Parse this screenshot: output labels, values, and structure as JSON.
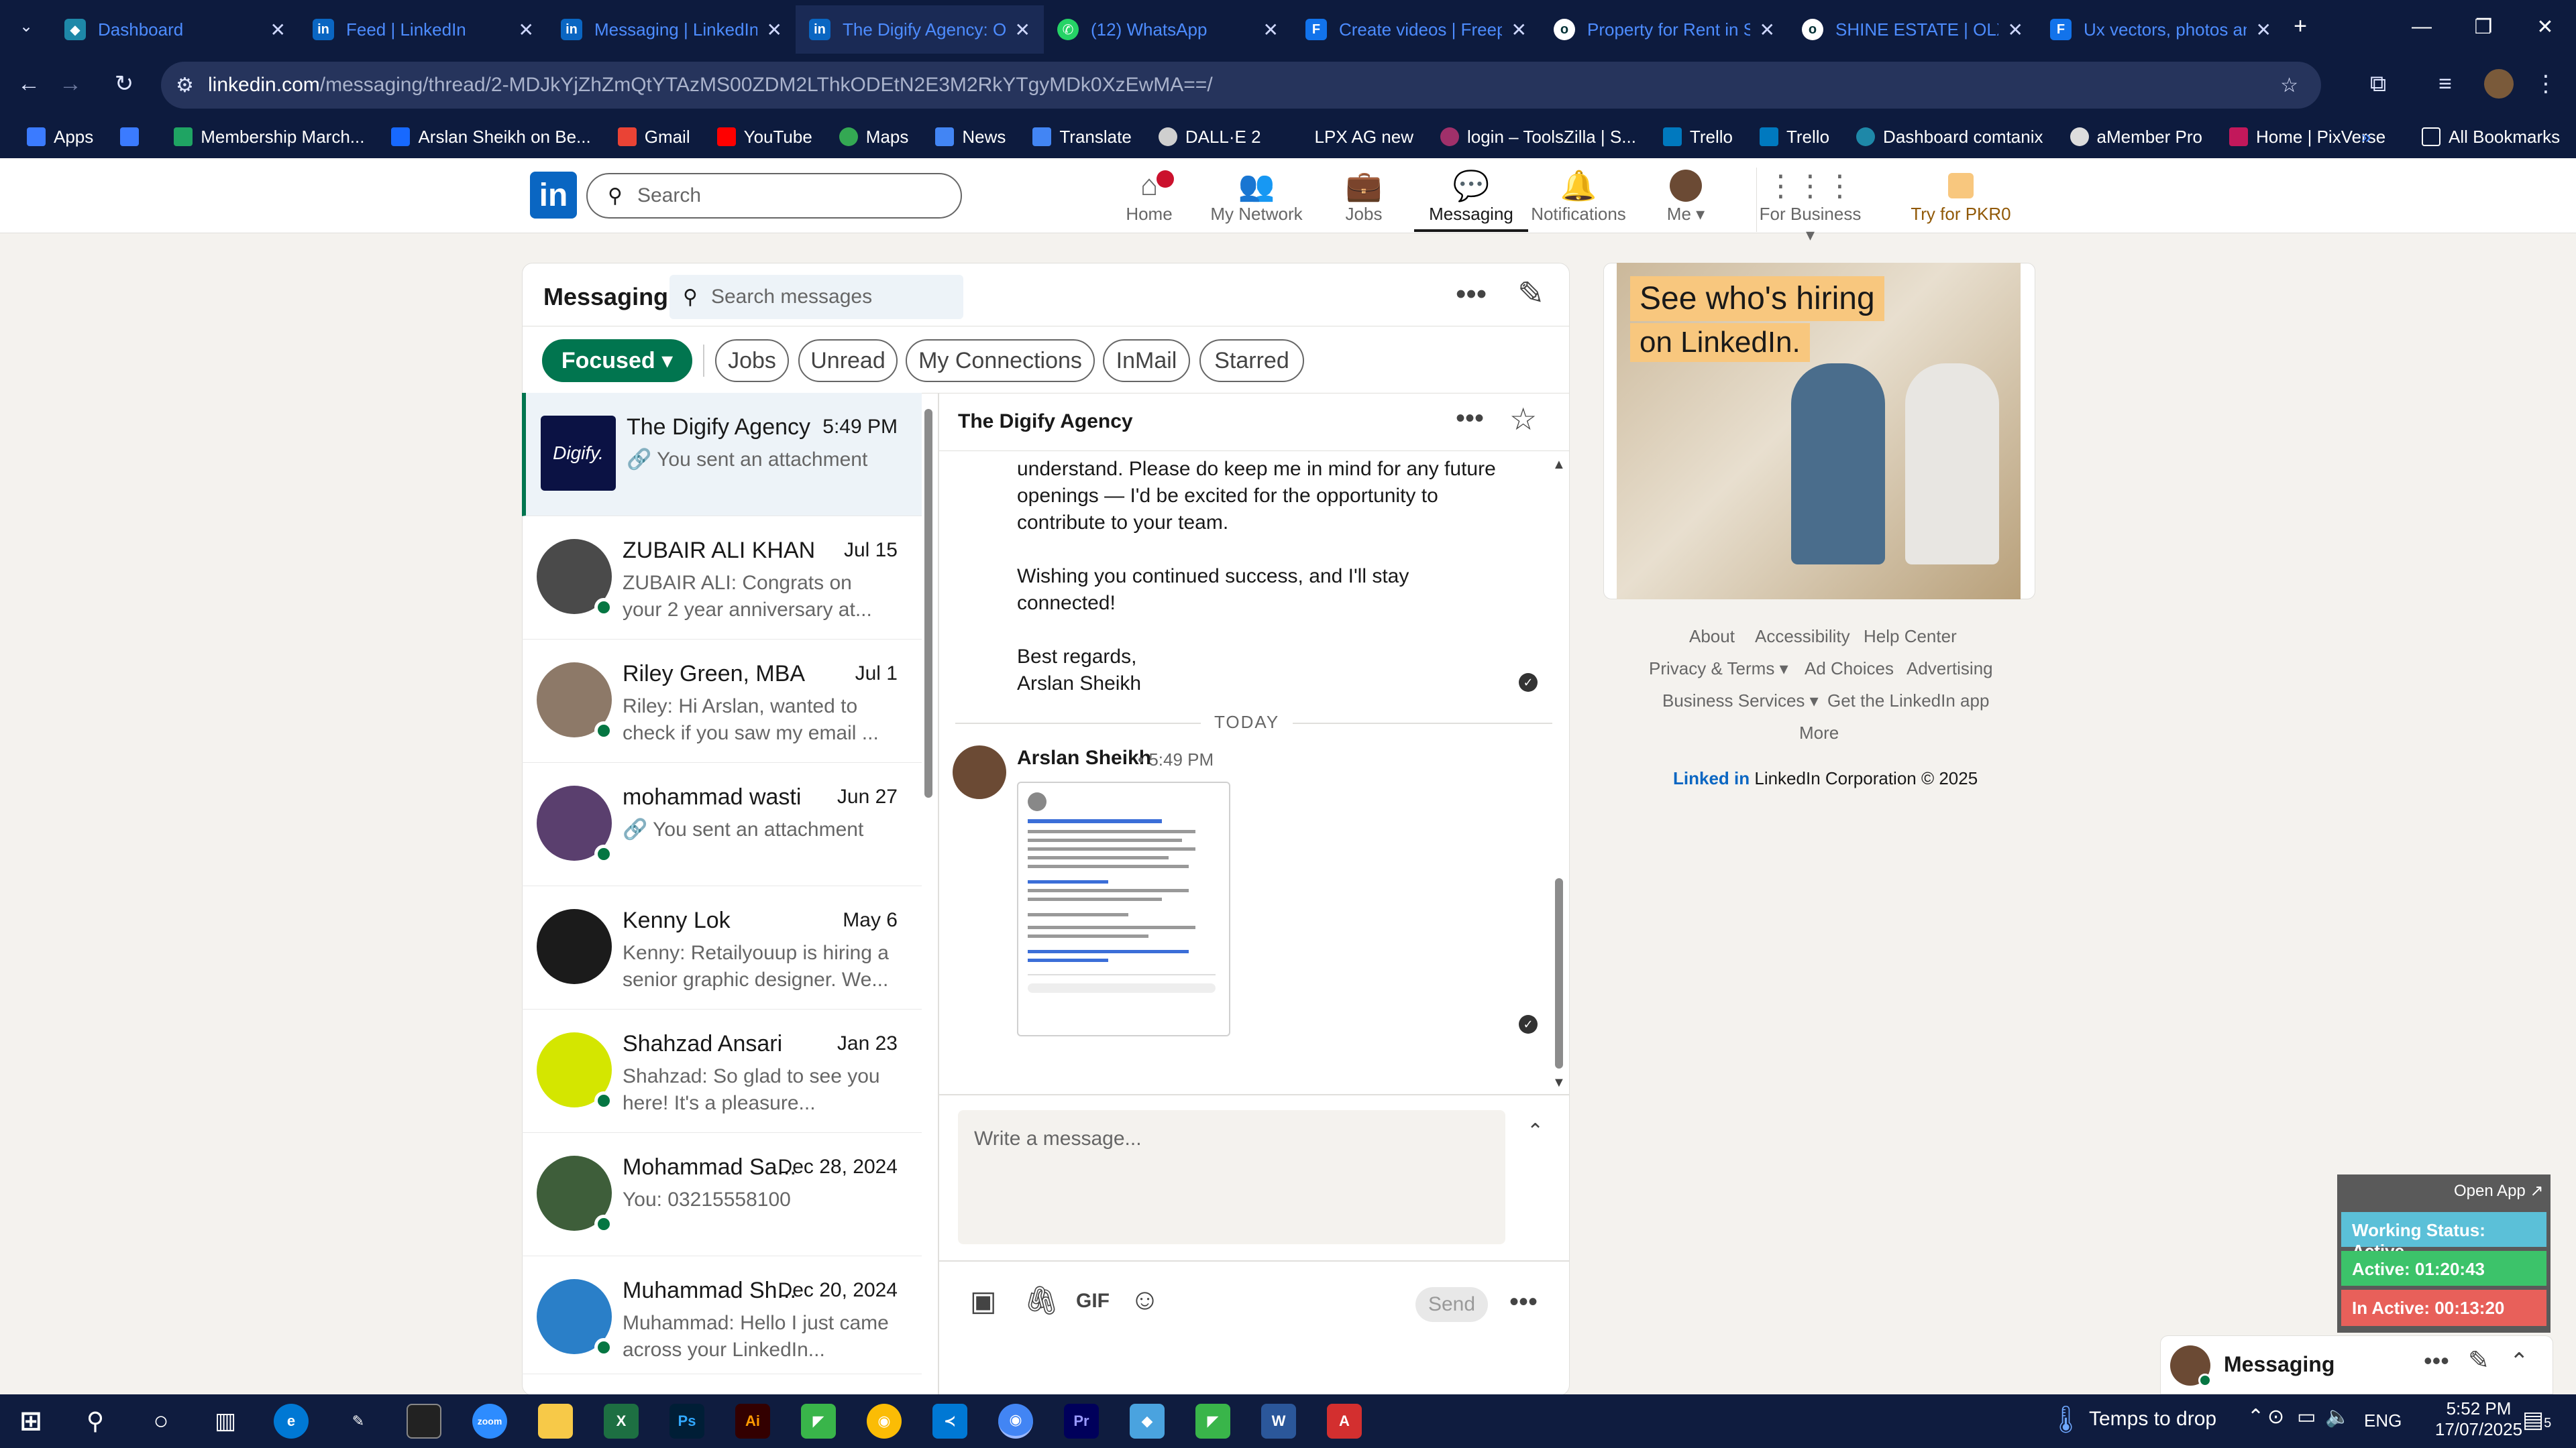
{
  "browser": {
    "tabs": [
      {
        "title": "Dashboard",
        "color": "#1e88a8"
      },
      {
        "title": "Feed | LinkedIn",
        "color": "#0a66c2"
      },
      {
        "title": "Messaging | LinkedIn",
        "color": "#0a66c2"
      },
      {
        "title": "The Digify Agency: Ov",
        "color": "#0a66c2"
      },
      {
        "title": "(12) WhatsApp",
        "color": "#25d366"
      },
      {
        "title": "Create videos | Freep",
        "color": "#1273eb"
      },
      {
        "title": "Property for Rent in S",
        "color": "#ffffff"
      },
      {
        "title": "SHINE ESTATE | OLX",
        "color": "#ffffff"
      },
      {
        "title": "Ux vectors, photos an",
        "color": "#1273eb"
      }
    ],
    "url_host": "linkedin.com",
    "url_path": "/messaging/thread/2-MDJkYjZhZmQtYTAzMS00ZDM2LThkODEtN2E3M2RkYTgyMDk0XzEwMA==/",
    "bookmarks": [
      "Apps",
      "Membership March...",
      "Arslan Sheikh on Be...",
      "Gmail",
      "YouTube",
      "Maps",
      "News",
      "Translate",
      "DALL·E 2",
      "LPX AG new",
      "login – ToolsZilla | S...",
      "Trello",
      "Trello",
      "Dashboard comtanix",
      "aMember Pro",
      "Home | PixVerse"
    ],
    "all_bookmarks": "All Bookmarks"
  },
  "linkedin_nav": {
    "logo": "in",
    "search_placeholder": "Search",
    "items": [
      "Home",
      "My Network",
      "Jobs",
      "Messaging",
      "Notifications",
      "Me",
      "For Business",
      "Try for PKR0"
    ]
  },
  "messaging": {
    "title": "Messaging",
    "search_placeholder": "Search messages",
    "filters": [
      "Focused",
      "Jobs",
      "Unread",
      "My Connections",
      "InMail",
      "Starred"
    ],
    "conversations": [
      {
        "name": "The Digify Agency",
        "date": "5:49 PM",
        "preview": "You sent an attachment"
      },
      {
        "name": "ZUBAIR ALI KHAN",
        "date": "Jul 15",
        "preview": "ZUBAIR ALI: Congrats on your 2 year anniversary at..."
      },
      {
        "name": "Riley Green, MBA",
        "date": "Jul 1",
        "preview": "Riley: Hi Arslan, wanted to check if you saw my email ..."
      },
      {
        "name": "mohammad wasti",
        "date": "Jun 27",
        "preview": "You sent an attachment"
      },
      {
        "name": "Kenny Lok",
        "date": "May 6",
        "preview": "Kenny: Retailyouup is hiring a senior graphic designer. We..."
      },
      {
        "name": "Shahzad Ansari",
        "date": "Jan 23",
        "preview": "Shahzad: So glad to see you here! It's a pleasure..."
      },
      {
        "name": "Mohammad Sa...",
        "date": "Dec 28, 2024",
        "preview": "You: 03215558100"
      },
      {
        "name": "Muhammad Sh...",
        "date": "Dec 20, 2024",
        "preview": "Muhammad: Hello I just came across your LinkedIn..."
      }
    ],
    "thread": {
      "title": "The Digify Agency",
      "body_lines": [
        "understand. Please do keep me in mind for any future",
        "openings — I'd be excited for the opportunity to",
        "contribute to your team.",
        "Wishing you continued success, and I'll stay",
        "connected!",
        "Best regards,",
        "Arslan Sheikh"
      ],
      "day_divider": "TODAY",
      "sender": "Arslan Sheikh",
      "time": "• 5:49 PM",
      "compose_placeholder": "Write a message...",
      "gif_label": "GIF",
      "send_label": "Send"
    }
  },
  "ad": {
    "line1": "See who's hiring",
    "line2": "on LinkedIn."
  },
  "footer_links": [
    "About",
    "Accessibility",
    "Help Center",
    "Privacy & Terms",
    "Ad Choices",
    "Advertising",
    "Business Services",
    "Get the LinkedIn app",
    "More"
  ],
  "copyright": "LinkedIn Corporation © 2025",
  "copyright_logo": "Linked in",
  "tracker": {
    "open_app": "Open App ↗",
    "working_status": "Working Status: Active",
    "active": "Active: 01:20:43",
    "inactive": "In Active: 00:13:20"
  },
  "minimized_messaging": "Messaging",
  "taskbar": {
    "drop_hint": "Temps to drop",
    "lang": "ENG",
    "time": "5:52 PM",
    "date": "17/07/2025",
    "notif_count": "5"
  }
}
